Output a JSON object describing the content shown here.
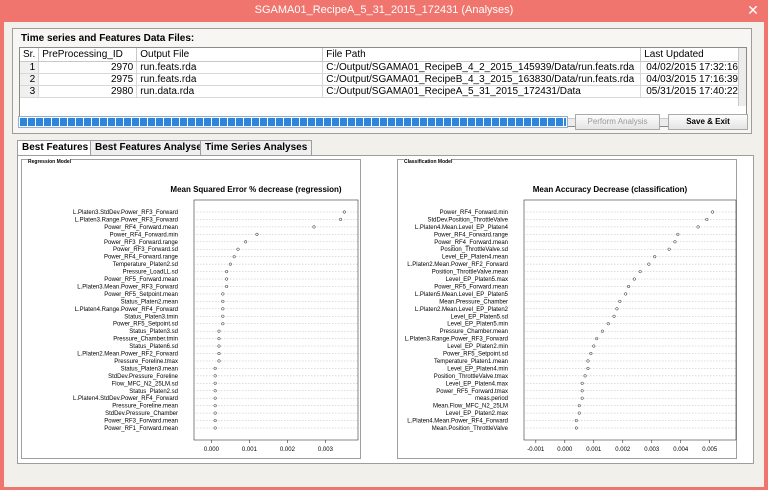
{
  "window": {
    "title": "SGAMA01_RecipeA_5_31_2015_172431 (Analyses)",
    "close_glyph": "✕"
  },
  "files_section": {
    "title": "Time series and Features Data Files:",
    "columns": [
      "Sr.",
      "PreProcessing_ID",
      "Output File",
      "File Path",
      "Last Updated"
    ],
    "rows": [
      {
        "sr": "1",
        "id": "2970",
        "output": "run.feats.rda",
        "path": "C:/Output/SGAMA01_RecipeB_4_2_2015_145939/Data/run.feats.rda",
        "updated": "04/02/2015 17:32:16"
      },
      {
        "sr": "2",
        "id": "2975",
        "output": "run.feats.rda",
        "path": "C:/Output/SGAMA01_RecipeB_4_3_2015_163830/Data/run.feats.rda",
        "updated": "04/03/2015 17:16:39"
      },
      {
        "sr": "3",
        "id": "2980",
        "output": "run.data.rda",
        "path": "C:/Output/SGAMA01_RecipeA_5_31_2015_172431/Data",
        "updated": "05/31/2015 17:40:22"
      }
    ]
  },
  "progress": {
    "fraction": 1.0
  },
  "buttons": {
    "perform_analysis": "Perform Analysis",
    "save_exit": "Save & Exit"
  },
  "tabs": [
    {
      "label": "Best Features",
      "active": true
    },
    {
      "label": "Best Features Analyses",
      "active": false
    },
    {
      "label": "Time Series Analyses",
      "active": false
    }
  ],
  "chart_data": [
    {
      "type": "scatter",
      "panel_label": "Regression Model",
      "title": "Mean Squared Error % decrease (regression)",
      "xlim": [
        -0.0003,
        0.0037
      ],
      "xticks": [
        "0.000",
        "0.001",
        "0.002",
        "0.003"
      ],
      "xtick_values": [
        0.0,
        0.001,
        0.002,
        0.003
      ],
      "categories": [
        "L.Platen3.StdDev.Power_RF3_Forward",
        "L.Platen3.Range.Power_RF3_Forward",
        "Power_RF4_Forward.mean",
        "Power_RF4_Forward.min",
        "Power_RF3_Forward.range",
        "Power_RF3_Forward.sd",
        "Power_RF4_Forward.range",
        "Temperature_Platen2.sd",
        "Pressure_LoadLL.sd",
        "Power_RF5_Forward.mean",
        "L.Platen3.Mean.Power_RF3_Forward",
        "Power_RF5_Setpoint.mean",
        "Status_Platen2.mean",
        "L.Platen4.Range.Power_RF4_Forward",
        "Status_Platen3.tmin",
        "Power_RF5_Setpoint.sd",
        "Status_Platen3.sd",
        "Pressure_Chamber.tmin",
        "Status_Platen6.sd",
        "L.Platen2.Mean.Power_RF2_Forward",
        "Pressure_Foreline.tmax",
        "Status_Platen3.mean",
        "StdDev.Pressure_Foreline",
        "Flow_MFC_N2_25LM.sd",
        "Status_Platen2.sd",
        "L.Platen4.StdDev.Power_RF4_Forward",
        "Pressure_Foreline.mean",
        "StdDev.Pressure_Chamber",
        "Power_RF3_Forward.mean",
        "Power_RF1_Forward.mean"
      ],
      "values": [
        0.0035,
        0.0034,
        0.0027,
        0.0012,
        0.0009,
        0.0007,
        0.0006,
        0.0005,
        0.0004,
        0.0004,
        0.0004,
        0.0003,
        0.0003,
        0.0003,
        0.0003,
        0.0003,
        0.0002,
        0.0002,
        0.0002,
        0.0002,
        0.0002,
        0.0001,
        0.0001,
        0.0001,
        0.0001,
        0.0001,
        0.0001,
        0.0001,
        0.0001,
        0.0001
      ]
    },
    {
      "type": "scatter",
      "panel_label": "Classification Model",
      "title": "Mean Accuracy Decrease (classification)",
      "xlim": [
        -0.0012,
        0.0057
      ],
      "xticks": [
        "-0.001",
        "0.000",
        "0.001",
        "0.002",
        "0.003",
        "0.004",
        "0.005"
      ],
      "xtick_values": [
        -0.001,
        0.0,
        0.001,
        0.002,
        0.003,
        0.004,
        0.005
      ],
      "categories": [
        "Power_RF4_Forward.min",
        "StdDev.Position_ThrottleValve",
        "L.Platen4.Mean.Level_EP_Platen4",
        "Power_RF4_Forward.range",
        "Power_RF4_Forward.mean",
        "Position_ThrottleValve.sd",
        "Level_EP_Platen4.mean",
        "L.Platen2.Mean.Power_RF2_Forward",
        "Position_ThrottleValve.mean",
        "Level_EP_Platen5.max",
        "Power_RF5_Forward.mean",
        "L.Platen5.Mean.Level_EP_Platen5",
        "Mean.Pressure_Chamber",
        "L.Platen2.Mean.Level_EP_Platen2",
        "Level_EP_Platen5.sd",
        "Level_EP_Platen5.min",
        "Pressure_Chamber.mean",
        "L.Platen3.Range.Power_RF3_Forward",
        "Level_EP_Platen2.min",
        "Power_RF5_Setpoint.sd",
        "Temperature_Platen1.mean",
        "Level_EP_Platen4.min",
        "Position_ThrottleValve.tmax",
        "Level_EP_Platen4.max",
        "Power_RF5_Forward.tmax",
        "meas.period",
        "Mean.Flow_MFC_N2_25LM",
        "Level_EP_Platen2.max",
        "L.Platen4.Mean.Power_RF4_Forward",
        "Mean.Position_ThrottleValve"
      ],
      "values": [
        0.0051,
        0.0049,
        0.0046,
        0.0039,
        0.0038,
        0.0036,
        0.0031,
        0.0029,
        0.0026,
        0.0024,
        0.0022,
        0.0021,
        0.0019,
        0.0018,
        0.0017,
        0.0015,
        0.0013,
        0.0011,
        0.001,
        0.0009,
        0.0008,
        0.0008,
        0.0007,
        0.0006,
        0.0006,
        0.0006,
        0.0005,
        0.0005,
        0.0004,
        0.0004
      ]
    }
  ]
}
